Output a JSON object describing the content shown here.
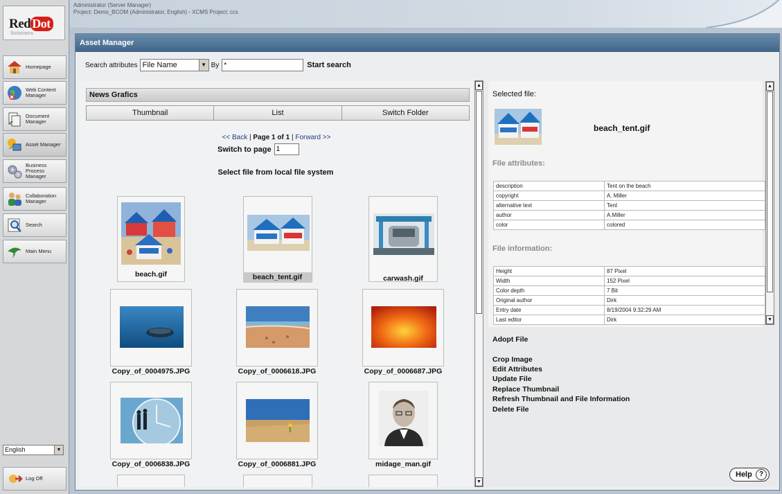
{
  "header": {
    "line1": "Administrator (Server Manager)",
    "line2": "Project: Demo_BCOM (Administrator, English) - XCMS Project: ccs"
  },
  "logo": {
    "brand_red": "Red",
    "brand_dot": "Dot",
    "sub": "Solutions"
  },
  "sidebar": {
    "items": [
      {
        "label": "Homepage",
        "icon": "house-icon"
      },
      {
        "label": "Web Content Manager",
        "icon": "globe-icon"
      },
      {
        "label": "Document Manager",
        "icon": "document-icon"
      },
      {
        "label": "Asset Manager",
        "icon": "assets-icon"
      },
      {
        "label": "Business Process Manager",
        "icon": "gears-icon"
      },
      {
        "label": "Collaboration Manager",
        "icon": "people-icon"
      },
      {
        "label": "Search",
        "icon": "magnifier-icon"
      },
      {
        "label": "Main Menu",
        "icon": "bird-icon"
      }
    ],
    "language": "English",
    "logoff": "Log Off"
  },
  "main": {
    "title": "Asset Manager",
    "search": {
      "label": "Search attributes",
      "attribute": "File Name",
      "by_label": "By",
      "value": "*",
      "button": "Start search"
    },
    "folder": "News Grafics",
    "tabs": [
      "Thumbnail",
      "List",
      "Switch Folder"
    ],
    "pager": {
      "back": "<< Back",
      "page": "Page 1 of 1",
      "forward": "Forward >>",
      "switch_label": "Switch to page",
      "page_value": "1"
    },
    "select_local": "Select file from local file system",
    "files": [
      "beach.gif",
      "beach_tent.gif",
      "carwash.gif",
      "Copy_of_0004975.JPG",
      "Copy_of_0006618.JPG",
      "Copy_of_0006687.JPG",
      "Copy_of_0006838.JPG",
      "Copy_of_0006881.JPG",
      "midage_man.gif"
    ]
  },
  "details": {
    "selected_label": "Selected file:",
    "selected_name": "beach_tent.gif",
    "attributes_head": "File attributes:",
    "attributes": [
      [
        "description",
        "Tent on the beach"
      ],
      [
        "copyright",
        "A. Miller"
      ],
      [
        "alternative text",
        "Tent"
      ],
      [
        "author",
        "A.Miller"
      ],
      [
        "color",
        "colored"
      ]
    ],
    "info_head": "File information:",
    "info": [
      [
        "Height",
        "87 Pixel"
      ],
      [
        "Width",
        "152 Pixel"
      ],
      [
        "Color depth",
        "7 Bit"
      ],
      [
        "Original author",
        "Dirk"
      ],
      [
        "Entry date",
        "8/19/2004 9:32:29 AM"
      ],
      [
        "Last editor",
        "Dirk"
      ]
    ]
  },
  "actions": {
    "adopt": "Adopt File",
    "list": [
      "Crop Image",
      "Edit Attributes",
      "Update File",
      "Replace Thumbnail",
      "Refresh Thumbnail and File Information",
      "Delete File"
    ]
  },
  "help": {
    "label": "Help",
    "icon": "?"
  },
  "colors": {
    "title_bar": "#4a6f91",
    "brand_red": "#d81e18",
    "background": "#b8c4d2"
  }
}
